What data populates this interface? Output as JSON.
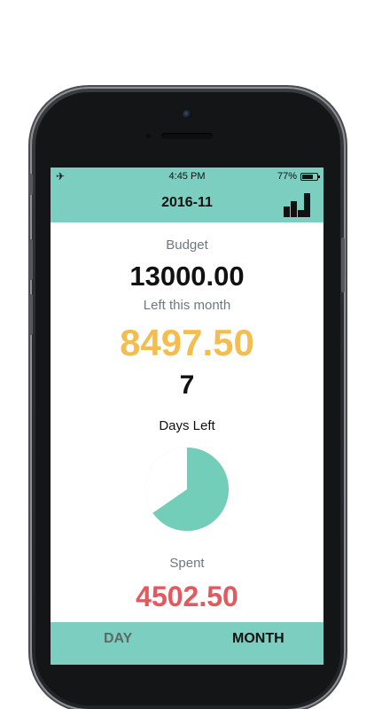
{
  "status_bar": {
    "airplane_icon": "airplane-icon",
    "time": "4:45 PM",
    "battery_text": "77%",
    "battery_level": 0.77
  },
  "header": {
    "title": "2016-11",
    "stats_icon": "bar-chart-icon"
  },
  "summary": {
    "budget_label": "Budget",
    "budget_value": "13000.00",
    "left_label": "Left this month",
    "left_value": "8497.50",
    "days_value": "7",
    "days_label": "Days Left",
    "spent_label": "Spent",
    "spent_value": "4502.50"
  },
  "chart_data": {
    "type": "pie",
    "values": [
      8497.5,
      4502.5
    ],
    "colors": [
      "#72cdb9",
      "#ffffff"
    ]
  },
  "tabs": {
    "day_label": "DAY",
    "month_label": "MONTH",
    "active": "MONTH"
  },
  "colors": {
    "accent": "#7ccfc0",
    "left_amount": "#f5bd4f",
    "spent_amount": "#e05a5f"
  }
}
